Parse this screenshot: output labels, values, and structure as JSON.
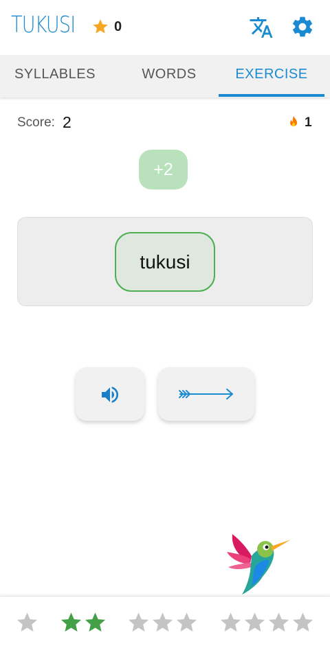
{
  "header": {
    "app_title": "TUKUSI",
    "star_count": "0",
    "icons": {
      "star": "star-icon",
      "translate": "translate-icon",
      "settings": "gear-icon"
    }
  },
  "tabs": [
    {
      "label": "SYLLABLES",
      "active": false
    },
    {
      "label": "WORDS",
      "active": false
    },
    {
      "label": "EXERCISE",
      "active": true
    }
  ],
  "exercise": {
    "score_label": "Score:",
    "score_value": "2",
    "streak_value": "1",
    "points_badge": "+2",
    "word": "tukusi"
  },
  "actions": {
    "play_sound_icon": "speaker-icon",
    "next_icon": "arrow-right-icon"
  },
  "levels": [
    {
      "stars": 1,
      "completed": 0
    },
    {
      "stars": 2,
      "completed": 2
    },
    {
      "stars": 3,
      "completed": 0
    },
    {
      "stars": 4,
      "completed": 0
    }
  ],
  "colors": {
    "accent": "#1a8ad1",
    "star_gold": "#f5a623",
    "star_green": "#43a047",
    "star_grey": "#c4c4c4",
    "success": "#4caf50"
  }
}
